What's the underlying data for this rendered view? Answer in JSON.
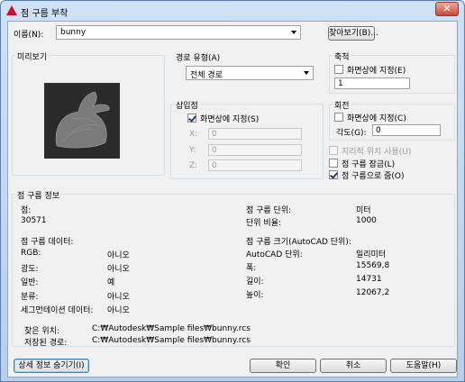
{
  "window": {
    "title": "점 구름 부착",
    "close_glyph": "✕"
  },
  "name_row": {
    "label": "이름(N):",
    "value": "bunny",
    "browse_button": "찾아보기(B)..."
  },
  "preview": {
    "title": "미리보기"
  },
  "path_type": {
    "title": "경로 유형(A)",
    "value": "전체 경로"
  },
  "insertion": {
    "title": "삽입점",
    "specify_label": "화면상에 지정(S)",
    "x_label": "X:",
    "x_value": "0",
    "y_label": "Y:",
    "y_value": "0",
    "z_label": "Z:",
    "z_value": "0"
  },
  "scale": {
    "title": "축척",
    "specify_label": "화면상에 지정(E)",
    "value": "1"
  },
  "rotation": {
    "title": "회전",
    "specify_label": "화면상에 지정(C)",
    "angle_label": "각도(G):",
    "angle_value": "0"
  },
  "options": {
    "geo_label": "지리적 위치 사용(U)",
    "lock_label": "점 구름 잠금(L)",
    "zoom_label": "점 구름으로 줌(O)"
  },
  "info": {
    "title": "점 구름 정보",
    "points_label": "점:",
    "points_value": "30571",
    "unit_label": "점 구름 단위:",
    "unit_value": "미터",
    "ratio_label": "단위 비율:",
    "ratio_value": "1000",
    "data_title": "점 구름 데이터:",
    "rgb_label": "RGB:",
    "rgb_value": "아니오",
    "intensity_label": "광도:",
    "intensity_value": "아니오",
    "normal_label": "일반:",
    "normal_value": "예",
    "class_label": "분류:",
    "class_value": "아니오",
    "seg_label": "세그먼테이션 데이터:",
    "seg_value": "아니오",
    "size_title": "점 구름 크기(AutoCAD 단위):",
    "acad_unit_label": "AutoCAD 단위:",
    "acad_unit_value": "밀리미터",
    "width_label": "폭:",
    "width_value": "15569,8",
    "length_label": "길이:",
    "length_value": "14731",
    "height_label": "높이:",
    "height_value": "12067,2"
  },
  "paths": {
    "found_label": "찾은 위치:",
    "found_value": "C:₩Autodesk₩Sample files₩bunny.rcs",
    "saved_label": "저장된 경로:",
    "saved_value": "C:₩Autodesk₩Sample files₩bunny.rcs"
  },
  "footer": {
    "hide_details": "상세 정보 숨기기(I)",
    "ok": "확인",
    "cancel": "취소",
    "help": "도움말(H)"
  }
}
